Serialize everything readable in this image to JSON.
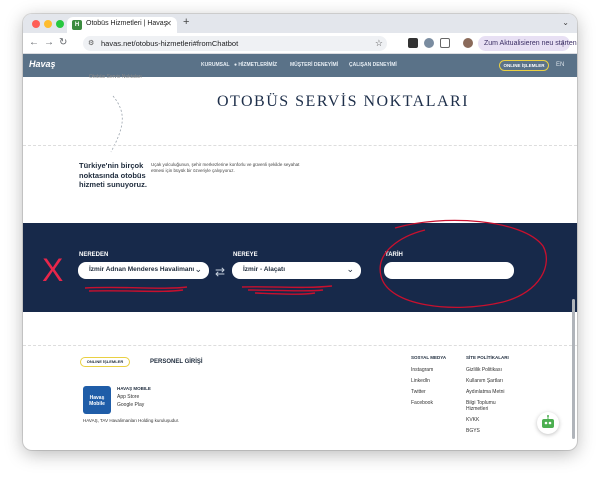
{
  "browser": {
    "tab_title": "Otobüs Hizmetleri | Havaş",
    "tab_close": "✕",
    "new_tab": "+",
    "url": "havas.net/otobus-hizmetleri#fromChatbot",
    "update_button": "Zum Aktualisieren neu starten"
  },
  "header": {
    "logo": "Havaş",
    "nav": [
      "KURUMSAL",
      "HİZMETLERİMİZ",
      "MÜŞTERİ DENEYİMİ",
      "ÇALIŞAN DENEYİMİ"
    ],
    "online_button": "ONLINE İŞLEMLER",
    "lang": "EN"
  },
  "hero": {
    "small_label": "Otobüs Servis Noktaları",
    "title": "OTOBÜS SERVİS NOKTALARI"
  },
  "intro": {
    "bold": "Türkiye'nin birçok noktasında otobüs hizmeti sunuyoruz.",
    "text": "Uçak yolculuğunun, şehir merkezlerine konforlu ve güvenli şekilde seyahat etmesi için büyük bir özveriyle çalışıyoruz."
  },
  "search": {
    "from_label": "NEREDEN",
    "from_value": "İzmir Adnan Menderes Havalimanı",
    "to_label": "NEREYE",
    "to_value": "İzmir - Alaçatı",
    "date_label": "TARİH",
    "date_value": ""
  },
  "footer": {
    "online_button": "ONLINE İŞLEMLER",
    "personel": "PERSONEL GİRİŞİ",
    "app_icon_text": "Havaş Mobile",
    "app_title": "HAVAŞ MOBILE",
    "app_store": "App Store",
    "google_play": "Google Play",
    "copyright": "HAVAŞ, TAV Havalimanları Holding kuruluşudur.",
    "social_head": "SOSYAL MEDYA",
    "social": [
      "Instagram",
      "LinkedIn",
      "Twitter",
      "Facebook"
    ],
    "policy_head": "SİTE POLİTİKALARI",
    "policies": [
      "Gizlilik Politikası",
      "Kullanım Şartları",
      "Aydınlatma Metni",
      "Bilgi Toplumu Hizmetleri",
      "KVKK",
      "BGYS"
    ]
  },
  "colors": {
    "header_bg": "#5a7288",
    "band_bg": "#17294a",
    "accent_yellow": "#e9d043",
    "annotation_red": "#c8102e"
  }
}
